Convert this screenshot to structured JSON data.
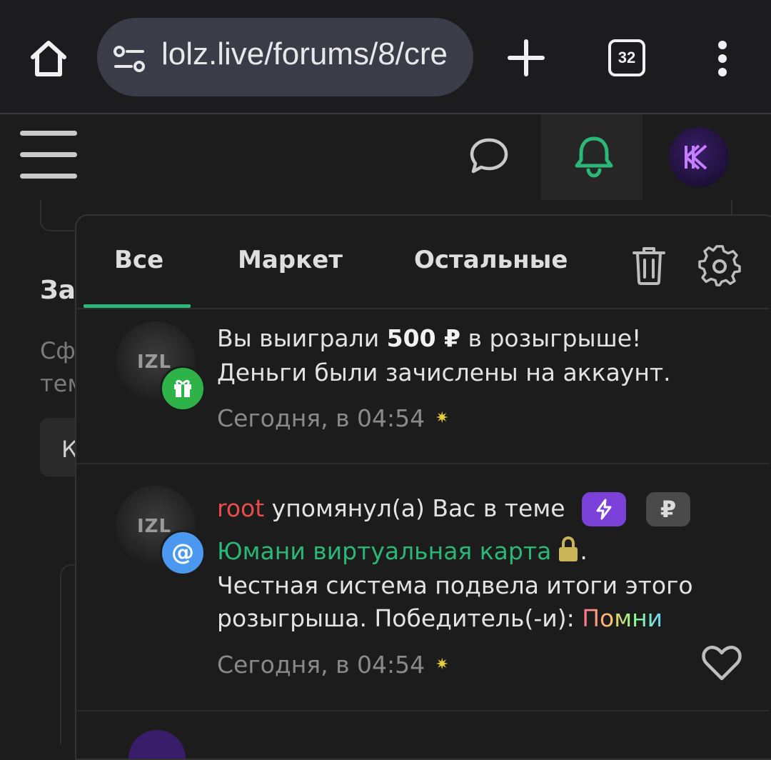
{
  "browser": {
    "url": "lolz.live/forums/8/cre",
    "tab_count": "32"
  },
  "background": {
    "heading_fragment": "За",
    "text_fragment_1": "Сф",
    "text_fragment_2": "тем",
    "button_fragment": "К"
  },
  "notifications": {
    "tabs": [
      "Все",
      "Маркет",
      "Остальные"
    ],
    "active_tab": "Все",
    "accent_color": "#2bb876",
    "items": [
      {
        "line1_before": "Вы выиграли ",
        "amount": "500 ₽",
        "line1_after": " в розыгрыше!",
        "line2": "Деньги были зачислены на аккаунт.",
        "time": "Сегодня, в 04:54",
        "badge": "gift-icon"
      },
      {
        "user": "root",
        "action": " упомянул(а) Вас в теме",
        "thread": "Юмани виртуальная карта",
        "period": ".",
        "line3": "Честная система подвела итоги этого",
        "line4_prefix": "розыгрыша. Победитель(-и): ",
        "winner": "Помни",
        "rub_pill": "₽",
        "time": "Сегодня, в 04:54",
        "badge": "@"
      }
    ],
    "avatar_text": "IZL"
  }
}
